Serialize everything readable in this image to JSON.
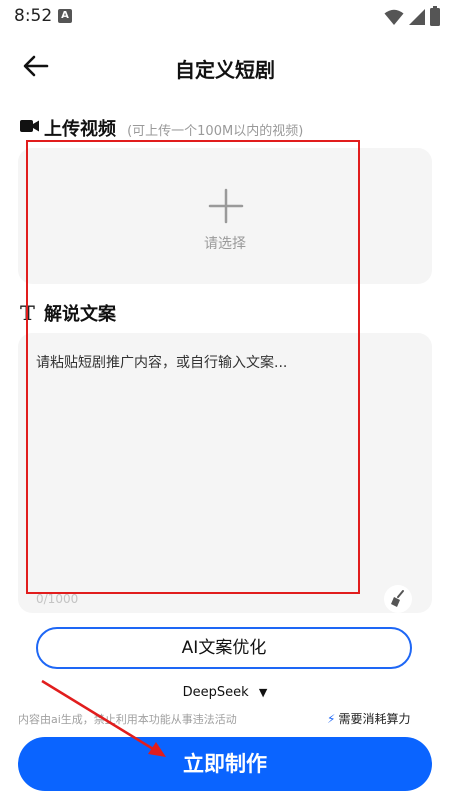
{
  "status_bar": {
    "time": "8:52",
    "notification_badge": "A"
  },
  "header": {
    "title": "自定义短剧"
  },
  "upload_section": {
    "title": "上传视频",
    "hint": "(可上传一个100M以内的视频)",
    "choose_label": "请选择"
  },
  "script_section": {
    "title": "解说文案",
    "placeholder": "请粘贴短剧推广内容，或自行输入文案...",
    "counter": "0/1000"
  },
  "ai_optimize_label": "AI文案优化",
  "model_select": {
    "selected": "DeepSeek"
  },
  "footer": {
    "notice": "内容由ai生成，禁止利用本功能从事违法活动",
    "cost_label": "需要消耗算力",
    "submit_label": "立即制作"
  },
  "colors": {
    "primary": "#0A64FF",
    "annotation": "#E11D1D"
  }
}
